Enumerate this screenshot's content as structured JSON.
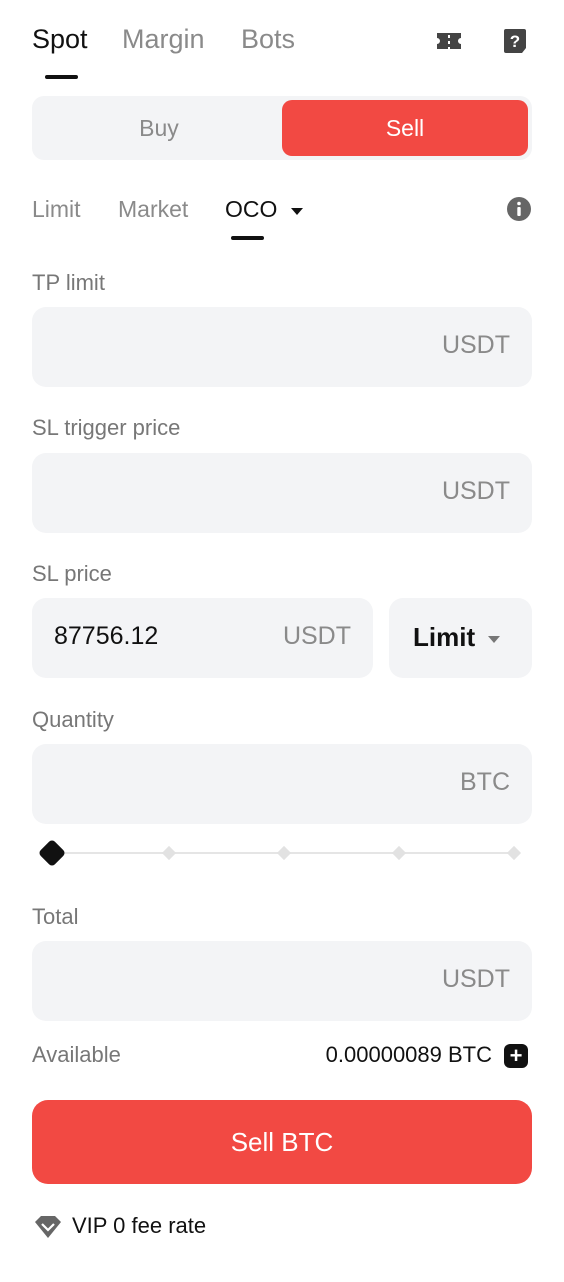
{
  "top_tabs": {
    "spot": "Spot",
    "margin": "Margin",
    "bots": "Bots"
  },
  "icons": {
    "ticket": "ticket-icon",
    "help": "help-icon",
    "info": "info-icon",
    "dropdown": "caret-down-icon",
    "plus": "plus-icon",
    "vip": "vip-diamond-icon"
  },
  "side": {
    "buy": "Buy",
    "sell": "Sell"
  },
  "order_types": {
    "limit": "Limit",
    "market": "Market",
    "oco": "OCO"
  },
  "tp_limit": {
    "label": "TP limit",
    "value": "",
    "unit": "USDT"
  },
  "sl_trigger": {
    "label": "SL trigger price",
    "value": "",
    "unit": "USDT"
  },
  "sl_price": {
    "label": "SL price",
    "value": "87756.12",
    "unit": "USDT",
    "type": "Limit"
  },
  "quantity": {
    "label": "Quantity",
    "value": "",
    "unit": "BTC",
    "slider_percent": 0
  },
  "total": {
    "label": "Total",
    "value": "",
    "unit": "USDT"
  },
  "available": {
    "label": "Available",
    "value": "0.00000089 BTC"
  },
  "submit": {
    "label": "Sell BTC"
  },
  "fee": {
    "label": "VIP 0 fee rate"
  },
  "colors": {
    "sell": "#f24943",
    "field_bg": "#f3f4f6",
    "muted": "#8a8a8a"
  }
}
